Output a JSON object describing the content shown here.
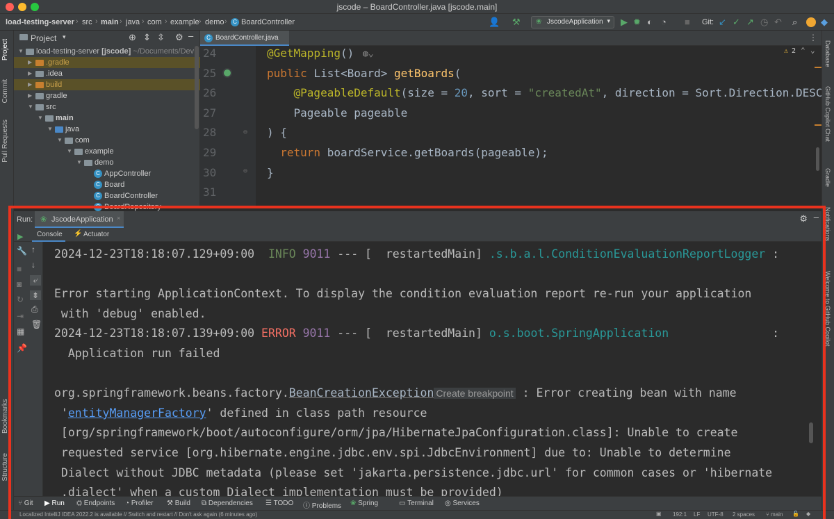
{
  "window": {
    "title": "jscode – BoardController.java [jscode.main]"
  },
  "breadcrumbs": [
    "load-testing-server",
    "src",
    "main",
    "java",
    "com",
    "example",
    "demo",
    "BoardController"
  ],
  "toolbar": {
    "run_config": "JscodeApplication",
    "git_label": "Git:"
  },
  "left_strip": {
    "project": "Project",
    "commit": "Commit",
    "pull_requests": "Pull Requests",
    "bookmarks": "Bookmarks",
    "structure": "Structure"
  },
  "right_strip": {
    "database": "Database",
    "copilot_chat": "GitHub Copilot Chat",
    "gradle": "Gradle",
    "notifications": "Notifications",
    "welcome": "Welcome to GitHub Copilot"
  },
  "project": {
    "title": "Project",
    "root_name": "load-testing-server",
    "root_module": "[jscode]",
    "root_path": "~/Documents/Dev",
    "items": [
      {
        "label": ".gradle",
        "depth": 1,
        "kind": "folder-orange",
        "hl": true
      },
      {
        "label": ".idea",
        "depth": 1,
        "kind": "folder-gray",
        "hl": false
      },
      {
        "label": "build",
        "depth": 1,
        "kind": "folder-orange",
        "hl": true
      },
      {
        "label": "gradle",
        "depth": 1,
        "kind": "folder-gray",
        "hl": false
      },
      {
        "label": "src",
        "depth": 1,
        "kind": "folder-gray",
        "hl": false,
        "open": true
      },
      {
        "label": "main",
        "depth": 2,
        "kind": "folder-gray",
        "hl": false,
        "open": true
      },
      {
        "label": "java",
        "depth": 3,
        "kind": "folder-blue",
        "hl": false,
        "open": true
      },
      {
        "label": "com",
        "depth": 4,
        "kind": "folder-gray",
        "hl": false,
        "open": true
      },
      {
        "label": "example",
        "depth": 5,
        "kind": "folder-gray",
        "hl": false,
        "open": true
      },
      {
        "label": "demo",
        "depth": 6,
        "kind": "folder-gray",
        "hl": false,
        "open": true
      },
      {
        "label": "AppController",
        "depth": 7,
        "kind": "class",
        "hl": false
      },
      {
        "label": "Board",
        "depth": 7,
        "kind": "class",
        "hl": false
      },
      {
        "label": "BoardController",
        "depth": 7,
        "kind": "class",
        "hl": false
      },
      {
        "label": "BoardRepository",
        "depth": 7,
        "kind": "class",
        "hl": false
      }
    ]
  },
  "editor": {
    "tab": "BoardController.java",
    "warnings": "2",
    "lines": [
      {
        "n": "24",
        "tokens": [
          {
            "t": "@GetMapping",
            "c": "ann"
          },
          {
            "t": "()",
            "c": ""
          }
        ]
      },
      {
        "n": "25",
        "tokens": [
          {
            "t": "public ",
            "c": "kw"
          },
          {
            "t": "List<Board> ",
            "c": ""
          },
          {
            "t": "getBoards",
            "c": "fn"
          },
          {
            "t": "(",
            "c": ""
          }
        ]
      },
      {
        "n": "26",
        "tokens": [
          {
            "t": "    @PageableDefault",
            "c": "ann"
          },
          {
            "t": "(size = ",
            "c": ""
          },
          {
            "t": "20",
            "c": "num"
          },
          {
            "t": ", sort = ",
            "c": ""
          },
          {
            "t": "\"createdAt\"",
            "c": "str"
          },
          {
            "t": ", direction = Sort.Direction.DESC)",
            "c": ""
          }
        ]
      },
      {
        "n": "27",
        "tokens": [
          {
            "t": "    Pageable pageable",
            "c": ""
          }
        ]
      },
      {
        "n": "28",
        "tokens": [
          {
            "t": ") {",
            "c": ""
          }
        ]
      },
      {
        "n": "29",
        "tokens": [
          {
            "t": "  return ",
            "c": "kw"
          },
          {
            "t": "boardService.getBoards(pageable);",
            "c": ""
          }
        ]
      },
      {
        "n": "30",
        "tokens": [
          {
            "t": "}",
            "c": ""
          }
        ]
      },
      {
        "n": "31",
        "tokens": []
      }
    ]
  },
  "run": {
    "label": "Run:",
    "app": "JscodeApplication",
    "tab_console": "Console",
    "tab_actuator": "Actuator",
    "console_lines": [
      [
        {
          "t": "2024-12-23T18:18:07.129+09:00  ",
          "c": ""
        },
        {
          "t": "INFO",
          "c": "info"
        },
        {
          "t": " ",
          "c": ""
        },
        {
          "t": "9011",
          "c": "pid"
        },
        {
          "t": " --- [  restartedMain] ",
          "c": ""
        },
        {
          "t": ".s.b.a.l.ConditionEvaluationReportLogger",
          "c": "logger"
        },
        {
          "t": " :",
          "c": ""
        }
      ],
      [],
      [
        {
          "t": "Error starting ApplicationContext. To display the condition evaluation report re-run your application",
          "c": ""
        }
      ],
      [
        {
          "t": " with 'debug' enabled.",
          "c": ""
        }
      ],
      [
        {
          "t": "2024-12-23T18:18:07.139+09:00 ",
          "c": ""
        },
        {
          "t": "ERROR",
          "c": "err"
        },
        {
          "t": " ",
          "c": ""
        },
        {
          "t": "9011",
          "c": "pid"
        },
        {
          "t": " --- [  restartedMain] ",
          "c": ""
        },
        {
          "t": "o.s.boot.SpringApplication",
          "c": "logger"
        },
        {
          "t": "               :",
          "c": ""
        }
      ],
      [
        {
          "t": "  Application run failed",
          "c": ""
        }
      ],
      [],
      [
        {
          "t": "org.springframework.beans.factory.",
          "c": ""
        },
        {
          "t": "BeanCreationException",
          "c": "exc"
        },
        {
          "t": "Create breakpoint",
          "c": "bp"
        },
        {
          "t": " : Error creating bean with name",
          "c": ""
        }
      ],
      [
        {
          "t": " '",
          "c": ""
        },
        {
          "t": "entityManagerFactory",
          "c": "link"
        },
        {
          "t": "' defined in class path resource",
          "c": ""
        }
      ],
      [
        {
          "t": " [org/springframework/boot/autoconfigure/orm/jpa/HibernateJpaConfiguration.class]: Unable to create",
          "c": ""
        }
      ],
      [
        {
          "t": " requested service [org.hibernate.engine.jdbc.env.spi.JdbcEnvironment] due to: Unable to determine",
          "c": ""
        }
      ],
      [
        {
          "t": " Dialect without JDBC metadata (please set 'jakarta.persistence.jdbc.url' for common cases or 'hibernate",
          "c": ""
        }
      ],
      [
        {
          "t": " .dialect' when a custom Dialect implementation must be provided)",
          "c": ""
        }
      ]
    ]
  },
  "bottom_tools": [
    "Git",
    "Run",
    "Endpoints",
    "Profiler",
    "Build",
    "Dependencies",
    "TODO",
    "Problems",
    "Spring",
    "Terminal",
    "Services"
  ],
  "status": {
    "message": "Localized IntelliJ IDEA 2022.2 is available // Switch and restart // Don't ask again (6 minutes ago)",
    "position": "192:1",
    "line_sep": "LF",
    "encoding": "UTF-8",
    "indent": "2 spaces",
    "branch": "main"
  },
  "colors": {
    "highlight_frame": "#e9321e",
    "accent": "#4a88c7"
  }
}
